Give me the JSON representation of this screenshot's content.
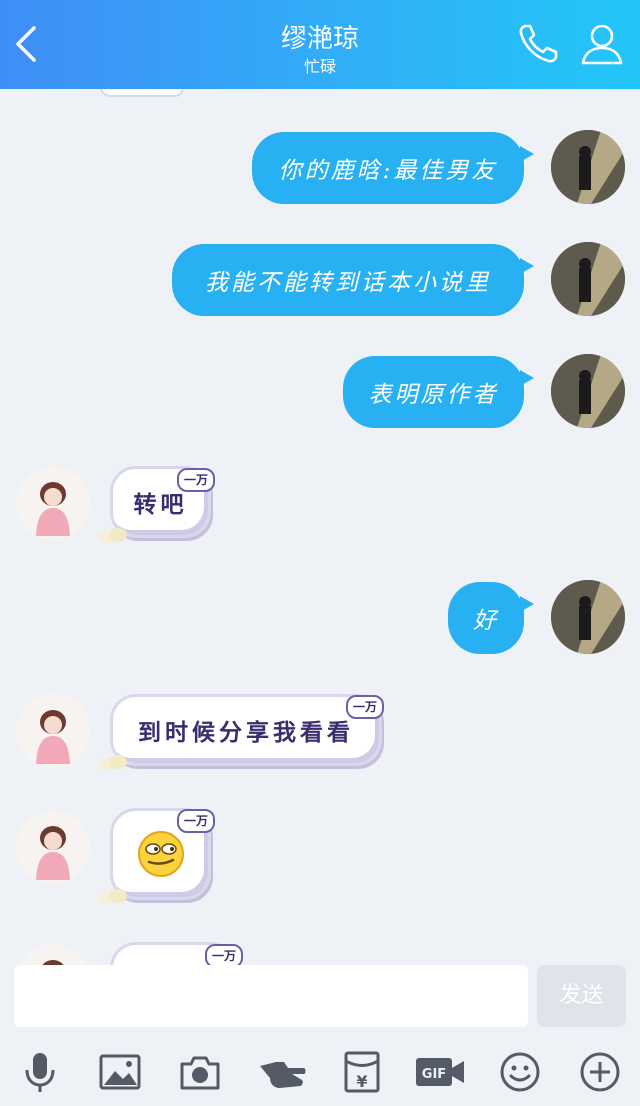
{
  "header": {
    "title": "缪滟琼",
    "status": "忙碌",
    "back_icon": "back-chevron-icon",
    "call_icon": "phone-icon",
    "profile_icon": "person-icon"
  },
  "messages": [
    {
      "from": "me",
      "text": "你的鹿晗:最佳男友"
    },
    {
      "from": "me",
      "text": "我能不能转到话本小说里"
    },
    {
      "from": "me",
      "text": "表明原作者"
    },
    {
      "from": "her",
      "text": "转吧",
      "badge": "一万"
    },
    {
      "from": "me",
      "text": "好"
    },
    {
      "from": "her",
      "text": "到时候分享我看看",
      "badge": "一万"
    },
    {
      "from": "her",
      "emoji": "smirk-emoji",
      "badge": "一万"
    },
    {
      "from": "her",
      "text": "",
      "badge": "一万"
    }
  ],
  "input": {
    "placeholder": "",
    "value": "",
    "send_label": "发送"
  },
  "toolbar": [
    "microphone-icon",
    "image-icon",
    "camera-icon",
    "poke-hand-icon",
    "red-packet-icon",
    "gif-icon",
    "emoji-icon",
    "plus-icon"
  ],
  "colors": {
    "header_start": "#3f8ef6",
    "header_end": "#22c6f8",
    "bubble_out": "#28b1f2",
    "page_bg": "#eef1f6"
  }
}
